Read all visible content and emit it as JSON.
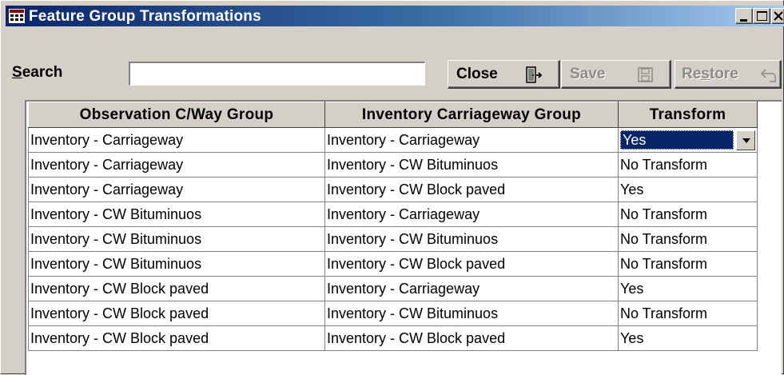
{
  "window": {
    "title": "Feature Group Transformations"
  },
  "toolbar": {
    "search_label_accel": "S",
    "search_label_rest": "earch",
    "search_value": "",
    "close_label": "Close",
    "save_label": "Save",
    "restore_label_pre": "Re",
    "restore_label_accel": "s",
    "restore_label_post": "tore"
  },
  "grid": {
    "columns": [
      "Observation C/Way Group",
      "Inventory Carriageway Group",
      "Transform"
    ],
    "rows": [
      [
        "Inventory - Carriageway",
        "Inventory - Carriageway",
        "Yes"
      ],
      [
        "Inventory - Carriageway",
        "Inventory - CW Bituminuos",
        "No Transform"
      ],
      [
        "Inventory - Carriageway",
        "Inventory - CW Block paved",
        "Yes"
      ],
      [
        "Inventory - CW Bituminuos",
        "Inventory - Carriageway",
        "No Transform"
      ],
      [
        "Inventory - CW Bituminuos",
        "Inventory - CW Bituminuos",
        "No Transform"
      ],
      [
        "Inventory - CW Bituminuos",
        "Inventory - CW Block paved",
        "No Transform"
      ],
      [
        "Inventory - CW Block paved",
        "Inventory - Carriageway",
        "Yes"
      ],
      [
        "Inventory - CW Block paved",
        "Inventory - CW Bituminuos",
        "No Transform"
      ],
      [
        "Inventory - CW Block paved",
        "Inventory - CW Block paved",
        "Yes"
      ]
    ],
    "active_row": 0
  },
  "colors": {
    "title_gradient_start": "#0a246a",
    "title_gradient_end": "#a6caf0",
    "selection": "#0a246a",
    "face": "#d4d0c8"
  },
  "icons": [
    "app-grid-icon",
    "minimize-icon",
    "maximize-icon",
    "close-icon",
    "exit-door-icon",
    "floppy-disk-icon",
    "undo-arrow-icon",
    "dropdown-arrow-icon"
  ]
}
